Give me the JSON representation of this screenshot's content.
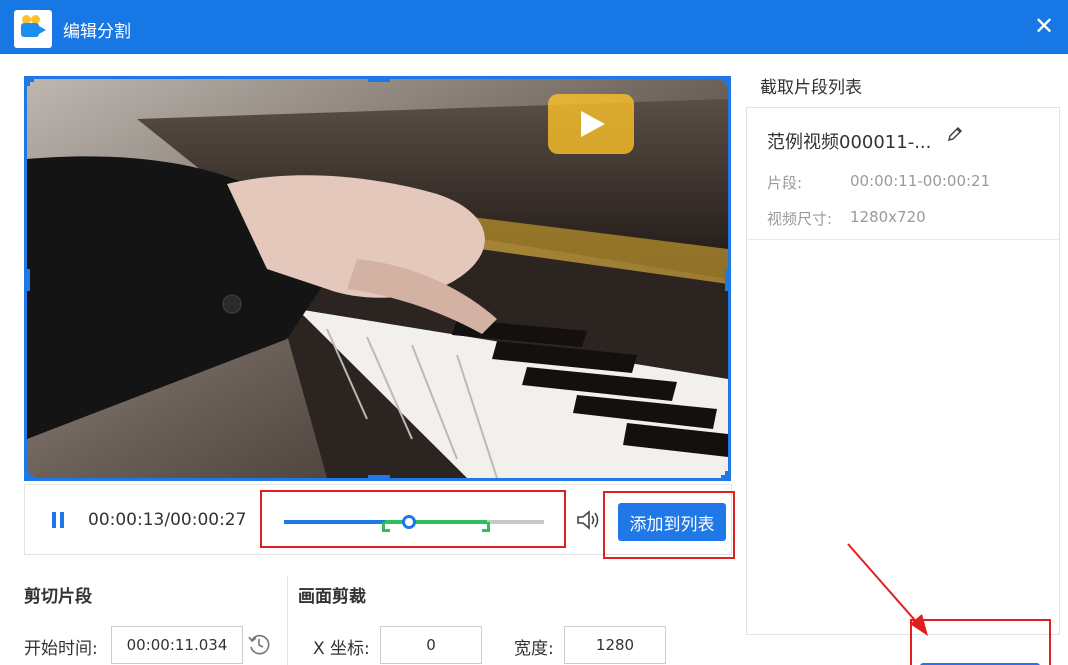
{
  "window": {
    "title": "编辑分割",
    "close_glyph": "✕",
    "app_icon": "video-camera-icon"
  },
  "player": {
    "timecode": "00:00:13/00:00:27",
    "progress": 0.48,
    "selection": [
      0.39,
      0.78
    ],
    "add_button": "添加到列表",
    "icons": [
      "pause-icon",
      "volume-icon",
      "play-icon"
    ]
  },
  "cut": {
    "section_title": "剪切片段",
    "start_label": "开始时间:",
    "start_value": "00:00:11.034"
  },
  "crop": {
    "section_title": "画面剪裁",
    "x_label": "X 坐标:",
    "x_value": "0",
    "width_label": "宽度:",
    "width_value": "1280"
  },
  "clip_list": {
    "title": "截取片段列表",
    "items": [
      {
        "name": "范例视频000011-...",
        "segment_label": "片段:",
        "segment_value": "00:00:11-00:00:21",
        "size_label": "视频尺寸:",
        "size_value": "1280x720"
      }
    ]
  },
  "colors": {
    "titlebar": "#1677e5",
    "accent": "#1f78e6",
    "selection": "#2bc05a",
    "annotation": "#e02020"
  }
}
